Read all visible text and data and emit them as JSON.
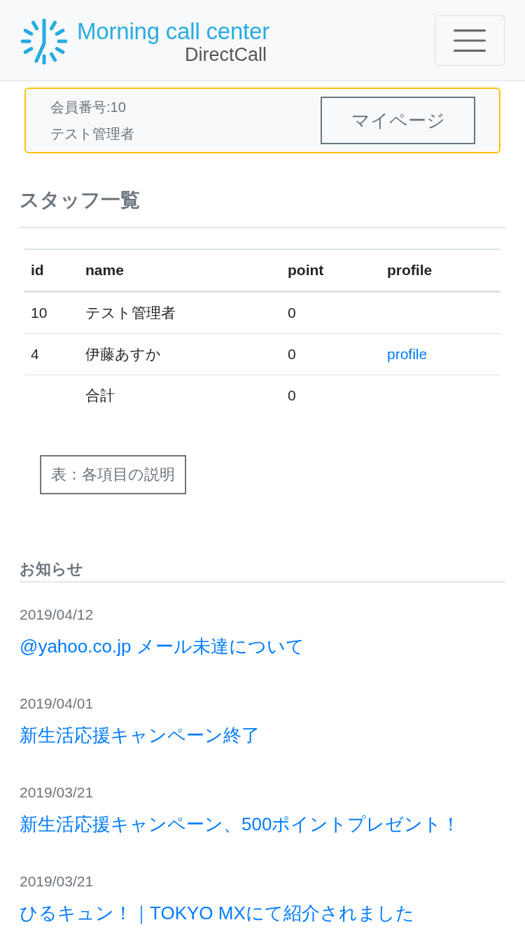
{
  "header": {
    "logo": {
      "title": "Morning call center",
      "subtitle": "DirectCall"
    }
  },
  "member_card": {
    "member_number": "会員番号:10",
    "member_name": "テスト管理者",
    "button": "マイページ"
  },
  "staff_section": {
    "title": "スタッフ一覧",
    "table": {
      "columns": [
        "id",
        "name",
        "point",
        "profile"
      ],
      "rows": [
        {
          "id": "10",
          "name": "テスト管理者",
          "point": "0"
        },
        {
          "id": "4",
          "name": "伊藤あすか",
          "point": "0",
          "profile": "profile"
        },
        {
          "name": "合計",
          "point": "0"
        }
      ]
    },
    "help_button": "表：各項目の説明"
  },
  "news": {
    "title": "お知らせ",
    "items": [
      {
        "date": "2019/04/12",
        "title": "@yahoo.co.jp メール未達について"
      },
      {
        "date": "2019/04/01",
        "title": "新生活応援キャンペーン終了"
      },
      {
        "date": "2019/03/21",
        "title": "新生活応援キャンペーン、500ポイントプレゼント！"
      },
      {
        "date": "2019/03/21",
        "title": "ひるキュン！｜TOKYO MXにて紹介されました"
      }
    ]
  }
}
